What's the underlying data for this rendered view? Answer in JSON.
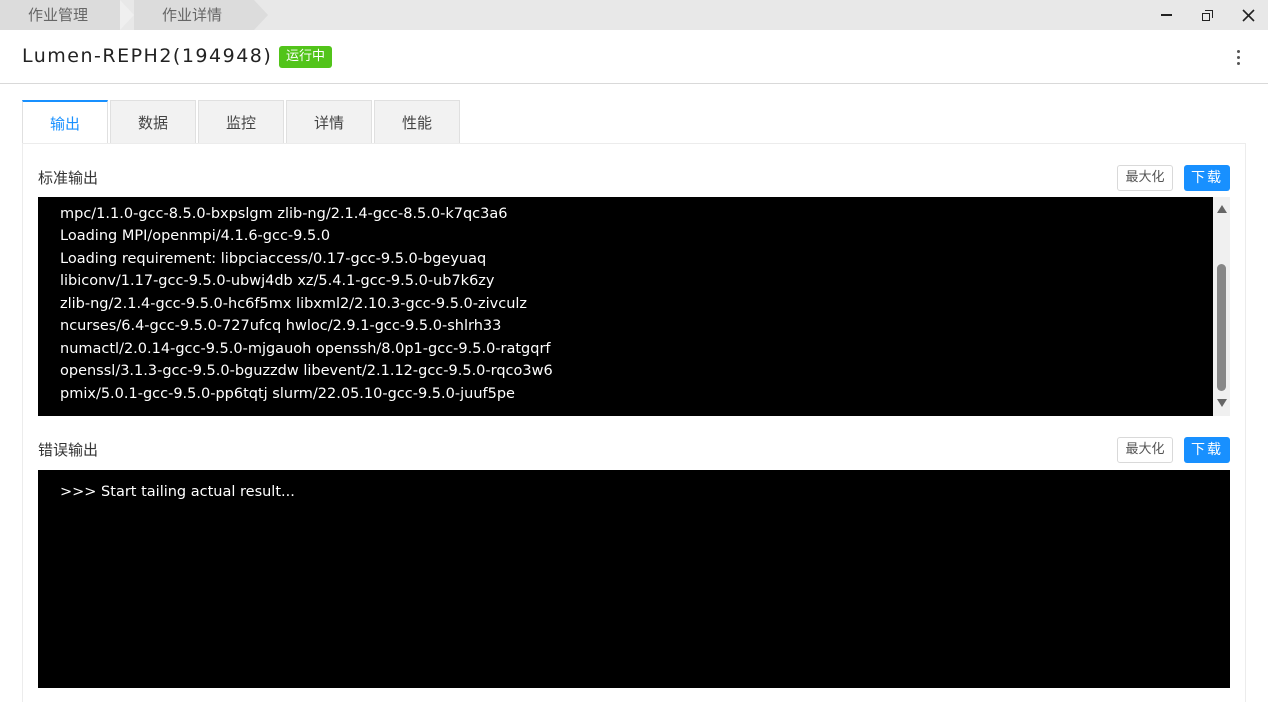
{
  "breadcrumb": [
    "作业管理",
    "作业详情"
  ],
  "header": {
    "job_title": "Lumen-REPH2(194948)",
    "status": "运行中",
    "status_color": "#52c41a"
  },
  "tabs": [
    {
      "label": "输出",
      "active": true
    },
    {
      "label": "数据",
      "active": false
    },
    {
      "label": "监控",
      "active": false
    },
    {
      "label": "详情",
      "active": false
    },
    {
      "label": "性能",
      "active": false
    }
  ],
  "stdout": {
    "title": "标准输出",
    "maximize_label": "最大化",
    "download_label": "下载",
    "lines": [
      "mpc/1.1.0-gcc-8.5.0-bxpslgm zlib-ng/2.1.4-gcc-8.5.0-k7qc3a6",
      "Loading MPI/openmpi/4.1.6-gcc-9.5.0",
      "Loading requirement: libpciaccess/0.17-gcc-9.5.0-bgeyuaq",
      "libiconv/1.17-gcc-9.5.0-ubwj4db xz/5.4.1-gcc-9.5.0-ub7k6zy",
      "zlib-ng/2.1.4-gcc-9.5.0-hc6f5mx libxml2/2.10.3-gcc-9.5.0-zivculz",
      "ncurses/6.4-gcc-9.5.0-727ufcq hwloc/2.9.1-gcc-9.5.0-shlrh33",
      "numactl/2.0.14-gcc-9.5.0-mjgauoh openssh/8.0p1-gcc-9.5.0-ratgqrf",
      "openssl/3.1.3-gcc-9.5.0-bguzzdw libevent/2.1.12-gcc-9.5.0-rqco3w6",
      "pmix/5.0.1-gcc-9.5.0-pp6tqtj slurm/22.05.10-gcc-9.5.0-juuf5pe"
    ]
  },
  "stderr": {
    "title": "错误输出",
    "maximize_label": "最大化",
    "download_label": "下载",
    "lines": [
      ">>> Start tailing actual result..."
    ]
  },
  "colors": {
    "accent": "#1890ff",
    "console_bg": "#000000"
  }
}
